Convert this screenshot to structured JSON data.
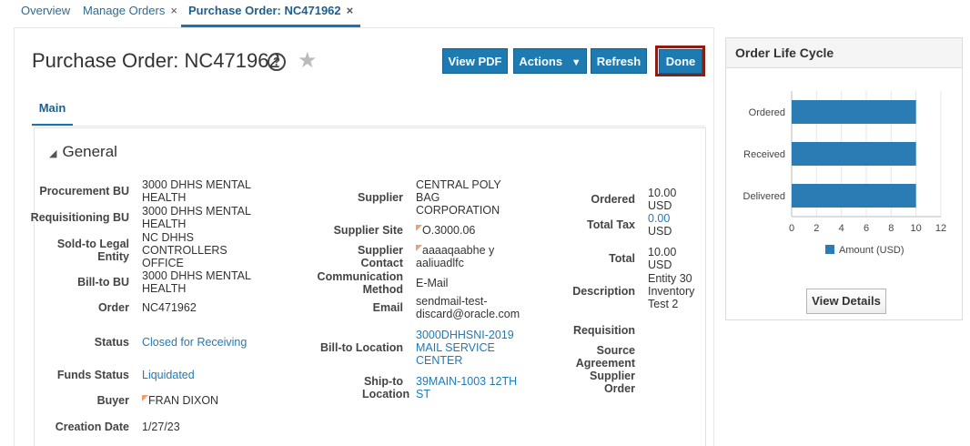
{
  "tabs": [
    {
      "label": "Overview"
    },
    {
      "label": "Manage Orders",
      "close": "×"
    },
    {
      "label": "Purchase Order: NC471962",
      "close": "×"
    }
  ],
  "page": {
    "title": "Purchase Order: NC471962",
    "help": "?",
    "star": "★"
  },
  "toolbar": {
    "view_pdf": "View PDF",
    "actions": "Actions",
    "actions_caret": "▼",
    "refresh": "Refresh",
    "done": "Done"
  },
  "main_tab": "Main",
  "section": {
    "title": "General",
    "toggle": "◢"
  },
  "col1": [
    {
      "label": "Procurement BU",
      "value": "3000 DHHS MENTAL HEALTH"
    },
    {
      "label": "Requisitioning BU",
      "value": "3000 DHHS MENTAL HEALTH"
    },
    {
      "label": "Sold-to Legal Entity",
      "value": "NC DHHS CONTROLLERS OFFICE"
    },
    {
      "label": "Bill-to BU",
      "value": "3000 DHHS MENTAL HEALTH"
    },
    {
      "label": "Order",
      "value": "NC471962"
    },
    {
      "label": "Status",
      "value": "Closed for Receiving"
    },
    {
      "label": "Funds Status",
      "value": "Liquidated"
    },
    {
      "label": "Buyer",
      "value": "FRAN DIXON"
    },
    {
      "label": "Creation Date",
      "value": "1/27/23"
    }
  ],
  "col2": [
    {
      "label": "Supplier",
      "value": "CENTRAL POLY BAG CORPORATION"
    },
    {
      "label": "Supplier Site",
      "value": "O.3000.06"
    },
    {
      "label": "Supplier Contact",
      "value": "aaaaqaabhe y aaliuadlfc"
    },
    {
      "label": "Communication Method",
      "value": "E-Mail"
    },
    {
      "label": "Email",
      "value": "sendmail-test-discard@oracle.com"
    },
    {
      "label": "Bill-to Location",
      "value": "3000DHHSNI-2019 MAIL SERVICE CENTER"
    },
    {
      "label": "Ship-to Location",
      "value": "39MAIN-1003 12TH ST"
    }
  ],
  "col3": [
    {
      "label": "Ordered",
      "value": "10.00 USD"
    },
    {
      "label": "Total Tax",
      "value": "0.00",
      "unit": "USD"
    },
    {
      "label": "Total",
      "value": "10.00 USD"
    },
    {
      "label": "Description",
      "value": "Entity 30 Inventory Test 2"
    },
    {
      "label": "Requisition",
      "value": ""
    },
    {
      "label": "Source Agreement",
      "value": ""
    },
    {
      "label": "Supplier Order",
      "value": ""
    }
  ],
  "panel": {
    "title": "Order Life Cycle",
    "view_details": "View Details"
  },
  "chart_data": {
    "type": "bar",
    "orientation": "horizontal",
    "categories": [
      "Ordered",
      "Received",
      "Delivered"
    ],
    "series": [
      {
        "name": "Amount (USD)",
        "values": [
          10,
          10,
          10
        ]
      }
    ],
    "xlim": [
      0,
      12
    ],
    "xticks": [
      0,
      2,
      4,
      6,
      8,
      10,
      12
    ],
    "legend": "bottom",
    "grid": true,
    "color": "#2b7bb5"
  }
}
